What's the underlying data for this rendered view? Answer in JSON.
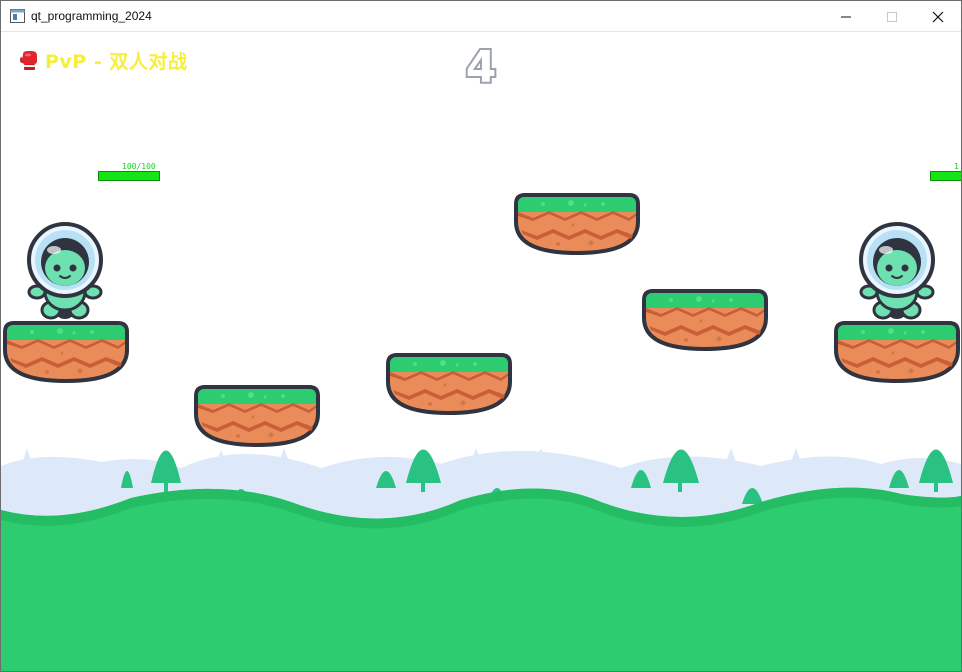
{
  "window": {
    "title": "qt_programming_2024"
  },
  "hud": {
    "mode_icon": "boxing-glove-icon",
    "mode_label": "PvP - 双人对战",
    "countdown_number": "4",
    "player1_hp_text": "100/100",
    "player2_hp_text": "1"
  },
  "colors": {
    "mode_text": "#f7ee3c",
    "hp_bar": "#14e514",
    "grass": "#2ecc71",
    "dirt": "#e98c5a",
    "hills": "#dde9f8",
    "alien": "#6fe0b0"
  }
}
